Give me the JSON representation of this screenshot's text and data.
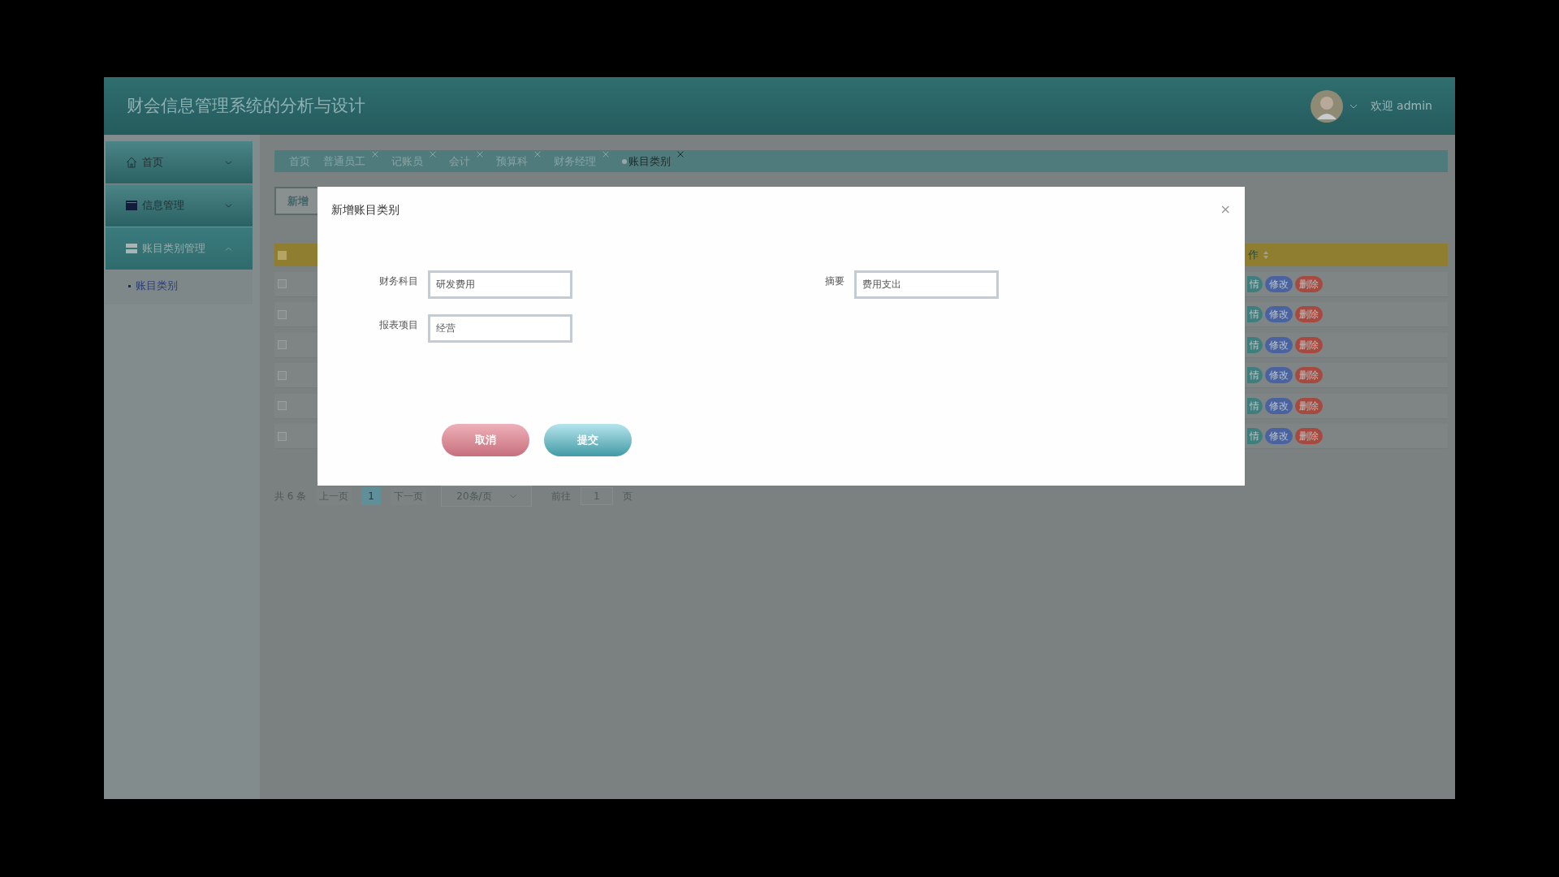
{
  "header": {
    "title": "财会信息管理系统的分析与设计",
    "user": "欢迎 admin"
  },
  "sidebar": {
    "items": [
      {
        "label": "首页",
        "kind": "home",
        "expanded": false
      },
      {
        "label": "信息管理",
        "kind": "card",
        "expanded": false
      },
      {
        "label": "账目类别管理",
        "kind": "list",
        "expanded": true,
        "children": [
          {
            "label": "账目类别",
            "selected": true
          }
        ]
      }
    ]
  },
  "tabs": [
    {
      "label": "首页",
      "selected": false,
      "closable": false
    },
    {
      "label": "普通员工",
      "selected": false,
      "closable": true
    },
    {
      "label": "记账员",
      "selected": false,
      "closable": true
    },
    {
      "label": "会计",
      "selected": false,
      "closable": true
    },
    {
      "label": "预算科",
      "selected": false,
      "closable": true
    },
    {
      "label": "财务经理",
      "selected": false,
      "closable": true
    },
    {
      "label": "账目类别",
      "selected": true,
      "closable": true
    }
  ],
  "toolbar": {
    "buttons": [
      "新增"
    ]
  },
  "table": {
    "header": {
      "checked": false,
      "column": "作"
    },
    "rows": [
      {
        "checked": false,
        "actions": [
          "情",
          "修改",
          "删除"
        ]
      },
      {
        "checked": false,
        "actions": [
          "情",
          "修改",
          "删除"
        ]
      },
      {
        "checked": false,
        "actions": [
          "情",
          "修改",
          "删除"
        ]
      },
      {
        "checked": false,
        "actions": [
          "情",
          "修改",
          "删除"
        ]
      },
      {
        "checked": false,
        "actions": [
          "情",
          "修改",
          "删除"
        ]
      },
      {
        "checked": false,
        "actions": [
          "情",
          "修改",
          "删除"
        ]
      }
    ]
  },
  "pagination": {
    "total": "共 6 条",
    "prev": "上一页",
    "current": "1",
    "next": "下一页",
    "page_size": "20条/页",
    "goto_label": "前往",
    "goto_value": "1",
    "goto_suffix": "页"
  },
  "dialog": {
    "title": "新增账目类别",
    "close": "×",
    "fields": [
      {
        "label": "财务科目",
        "value": "研发费用"
      },
      {
        "label": "摘要",
        "value": "费用支出"
      },
      {
        "label": "报表项目",
        "value": "经营"
      }
    ],
    "buttons": [
      {
        "label": "取消",
        "kind": "cancel"
      },
      {
        "label": "提交",
        "kind": "submit"
      }
    ]
  }
}
